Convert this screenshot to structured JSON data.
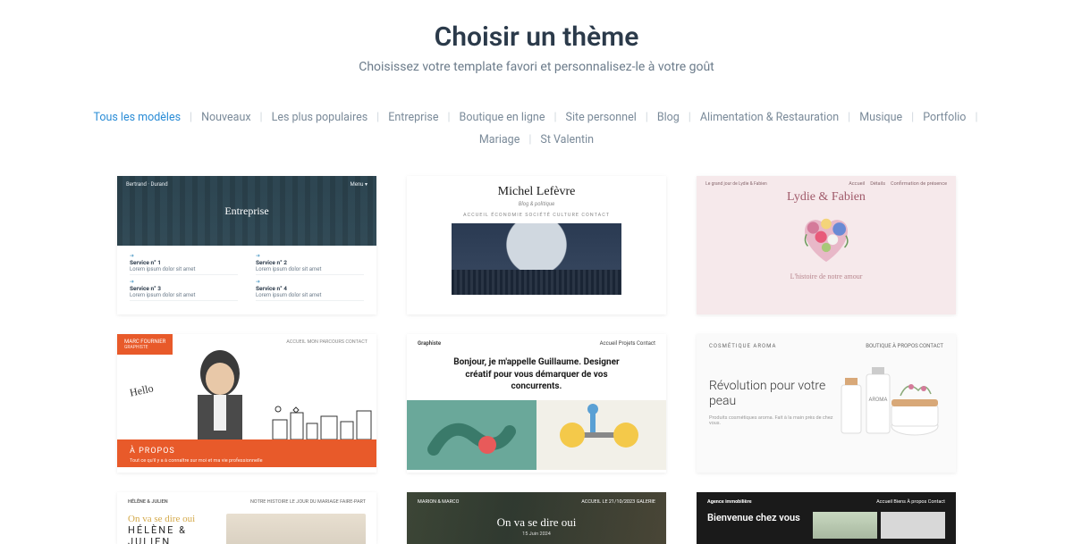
{
  "header": {
    "title": "Choisir un thème",
    "subtitle": "Choisissez votre template favori et personnalisez-le à votre goût"
  },
  "filters": {
    "active_index": 0,
    "items": [
      "Tous les modèles",
      "Nouveaux",
      "Les plus populaires",
      "Entreprise",
      "Boutique en ligne",
      "Site personnel",
      "Blog",
      "Alimentation & Restauration",
      "Musique",
      "Portfolio",
      "Mariage",
      "St Valentin"
    ]
  },
  "cards": {
    "c1": {
      "brand": "Bertrand · Durand",
      "nav": "Menu ▾",
      "hero_title": "Entreprise",
      "services": [
        {
          "name": "Service n° 1",
          "desc": "Lorem ipsum dolor sit amet"
        },
        {
          "name": "Service n° 2",
          "desc": "Lorem ipsum dolor sit amet"
        },
        {
          "name": "Service n° 3",
          "desc": "Lorem ipsum dolor sit amet"
        },
        {
          "name": "Service n° 4",
          "desc": "Lorem ipsum dolor sit amet"
        }
      ]
    },
    "c2": {
      "name": "Michel Lefèvre",
      "sub": "Blog & politique",
      "nav": "ACCUEIL   ÉCONOMIE   SOCIÉTÉ   CULTURE   CONTACT"
    },
    "c3": {
      "top_left": "Le grand jour de Lydie & Fabien",
      "nav": [
        "Accueil",
        "Détails",
        "Confirmation de présence"
      ],
      "title": "Lydie & Fabien",
      "footer": "L'histoire de notre amour"
    },
    "c4": {
      "badge_name": "MARC FOURNIER",
      "badge_role": "GRAPHISTE",
      "nav": "ACCUEIL   MON PARCOURS   CONTACT",
      "hello": "Hello",
      "footer_title": "À PROPOS",
      "footer_sub": "Tout ce qu'il y a à connaître sur moi et ma vie professionnelle"
    },
    "c5": {
      "brand": "Graphiste",
      "nav": "Accueil   Projets   Contact",
      "title": "Bonjour, je m'appelle Guillaume. Designer créatif pour vous démarquer de vos concurrents."
    },
    "c6": {
      "brand": "COSMÉTIQUE AROMA",
      "nav": "BOUTIQUE   À PROPOS   CONTACT",
      "title": "Révolution pour votre peau",
      "sub": "Produits cosmétiques aroma. Fait à la main près de chez vous.",
      "product_label": "AROMA"
    },
    "c7": {
      "brand": "HÉLÈNE & JULIEN",
      "nav": "NOTRE HISTOIRE   LE JOUR DU MARIAGE   FAIRE-PART",
      "script": "On va se dire oui",
      "names": "HÉLÈNE & JULIEN"
    },
    "c8": {
      "brand": "MARION & MARCO",
      "nav": "ACCUEIL   LE 21/10/2023   GALERIE",
      "title": "On va se dire oui",
      "date": "15 Juin 2024"
    },
    "c9": {
      "brand": "Agence immobilière",
      "nav": "Accueil   Biens   À propos   Contact",
      "title": "Bienvenue chez vous"
    }
  }
}
